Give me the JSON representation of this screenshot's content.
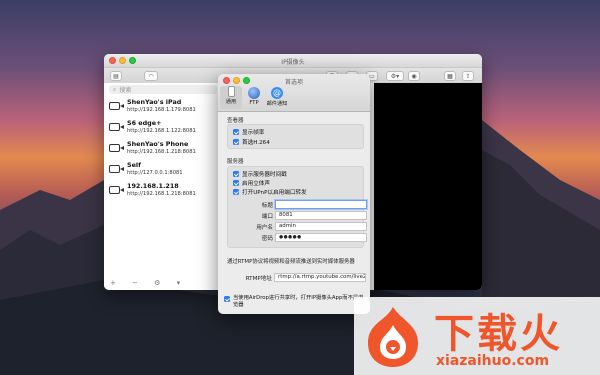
{
  "main_window": {
    "title": "IP摄像头",
    "search_placeholder": "搜索",
    "devices": [
      {
        "name": "ShenYao's iPad",
        "url": "http://192.168.1.179:8081"
      },
      {
        "name": "S6 edge+",
        "url": "http://192.168.1.122:8081"
      },
      {
        "name": "ShenYao's Phone",
        "url": "http://192.168.1.218:8081"
      },
      {
        "name": "Self",
        "url": "http://127.0.0.1:8081"
      },
      {
        "name": "192.168.1.218",
        "url": "http://192.168.1.218:8081"
      }
    ],
    "footer_icons": "+  −  ⚙  ▾"
  },
  "preferences": {
    "title": "首选项",
    "tabs": [
      {
        "label": "通用",
        "icon": "phone-icon",
        "active": true
      },
      {
        "label": "FTP",
        "icon": "globe-icon",
        "active": false
      },
      {
        "label": "邮件通知",
        "icon": "at-icon",
        "active": false
      }
    ],
    "viewer_section": "查看器",
    "viewer_options": [
      "显示帧率",
      "首选H.264"
    ],
    "server_section": "服务器",
    "server_options": [
      "显示服务器时间戳",
      "启用立体声",
      "打开UPnP以启用端口转发"
    ],
    "fields": [
      {
        "label": "标题",
        "value": ""
      },
      {
        "label": "端口",
        "value": "8081"
      },
      {
        "label": "用户名",
        "value": "admin"
      },
      {
        "label": "密码",
        "value": "●●●●●"
      }
    ],
    "rtmp_note": "通过RTMP协议将视频和音频流推送到实时媒体服务器",
    "rtmp_label": "RTMP地址",
    "rtmp_value": "rtmp://a.rtmp.youtube.com/live2/x4",
    "airdrop_note": "当使用AirDrop进行共享时，打开IP摄像头App而不是浏览器"
  },
  "watermark": {
    "brand": "下载火",
    "domain": "xiazaihuo.com"
  },
  "colors": {
    "accent": "#2f7bf5",
    "brand_orange": "#f0562b"
  }
}
